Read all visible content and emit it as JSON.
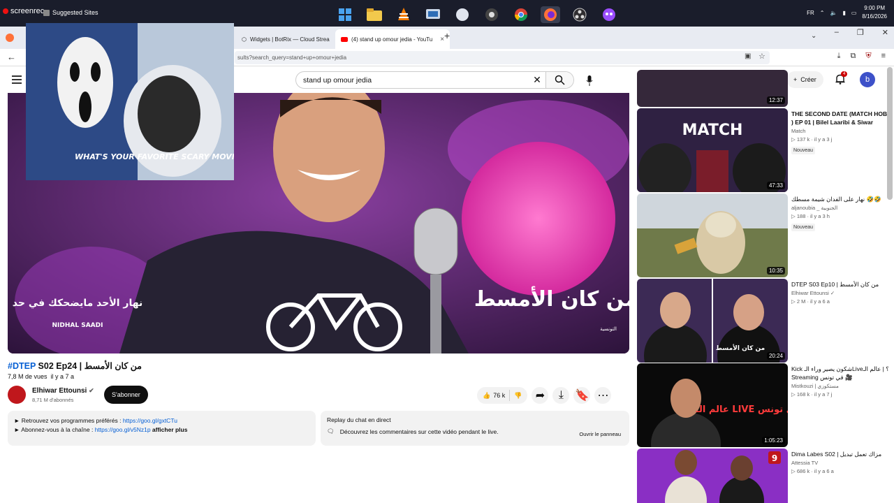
{
  "taskbar": {
    "recorder_label": "screenrec",
    "suggested_sites": "Suggested Sites",
    "apps": [
      "windows-start",
      "file-explorer",
      "vlc",
      "network-tool",
      "app-circle",
      "gamer-app",
      "chrome",
      "firefox",
      "obs",
      "emulator"
    ],
    "lang": "FR",
    "time": "9:00 PM",
    "date": "8/16/2026"
  },
  "browser": {
    "tabs": [
      {
        "title": "Widgets | BotRix — Cloud Strea"
      },
      {
        "title": "(4) stand up omour jedia - YouTu"
      }
    ],
    "url": "sults?search_query=stand+up+omour+jedia"
  },
  "youtube": {
    "search_query": "stand up omour jedia",
    "create_label": "Créer",
    "notif_count": "4",
    "avatar_letter": "b"
  },
  "video": {
    "title_tag": "#DTEP",
    "title_rest": " S02 Ep24 | من كان الأمسط",
    "views": "7,8 M de vues",
    "age": "il y a 7 a",
    "channel": "Elhiwar Ettounsi",
    "subs": "8,71 M d'abonnés",
    "subscribe": "S'abonner",
    "likes": "76 k",
    "overlay_title": "من كان الأمسط",
    "overlay_show": "نهار الأحد مايضحكك في حد",
    "overlay_host": "NIDHAL SAADI",
    "overlay_channel": "التونسية"
  },
  "description": {
    "line1_prefix": "► Retrouvez vos programmes préférés : ",
    "line1_link": "https://goo.gl/gxtCTu",
    "line2_prefix": "► Abonnez-vous à la chaîne : ",
    "line2_link": "https://goo.gl/v5Nz1p",
    "more": "afficher plus"
  },
  "chat": {
    "title": "Replay du chat en direct",
    "body": "Découvrez les commentaires sur cette vidéo pendant le live.",
    "open": "Ouvrir le panneau"
  },
  "webcam": {
    "poster_text": "WHAT'S YOUR FAVORITE SCARY MOVIE"
  },
  "recommendations": [
    {
      "title": "",
      "channel": "",
      "meta": "",
      "duration": "12:37",
      "badge": "",
      "thumb_text": ""
    },
    {
      "title": "THE SECOND DATE (MATCH HOB ) EP 01 | Bilel Laaribi & Siwar",
      "channel": "Match",
      "meta": "▷ 137 k · il y a 3 j",
      "duration": "47:33",
      "badge": "Nouveau",
      "thumb_text": "MATCH"
    },
    {
      "title": "نهار على الفدان شيمة مسطك 🤣🤣",
      "channel": "aljanoubia _ الجنوبية",
      "meta": "▷ 188 · il y a 3 h",
      "duration": "10:35",
      "badge": "Nouveau",
      "thumb_text": ""
    },
    {
      "title": "DTEP S03 Ep10 | من كان الأمسط",
      "channel": "Elhiwar Ettounsi ✓",
      "meta": "▷ 2 M · il y a 6 a",
      "duration": "20:24",
      "badge": "",
      "thumb_text": "من كان الأمسط"
    },
    {
      "title": "Kick شكون يصير وراء الـLive؟ | عالم الـ Streaming في تونس 🎥",
      "channel": "Mistkouzi | مستكوزي",
      "meta": "▷ 168 k · il y a 7 j",
      "duration": "1:05:23",
      "badge": "",
      "thumb_text": "عالم الـ LIVE في تونس"
    },
    {
      "title": "Dima Labes S02 | مزاك تعمل تبديل",
      "channel": "Attessia TV",
      "meta": "▷ 686 k · il y a 6 a",
      "duration": "",
      "badge": "",
      "thumb_text": "9"
    }
  ]
}
